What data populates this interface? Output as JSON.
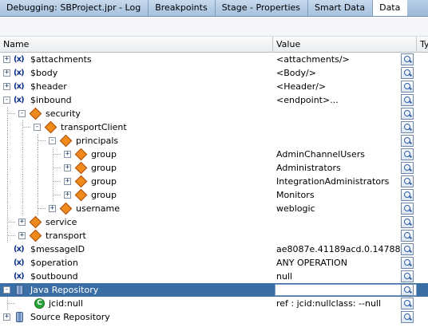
{
  "tabs": [
    {
      "label": "Debugging: SBProject.jpr - Log",
      "active": false
    },
    {
      "label": "Breakpoints",
      "active": false
    },
    {
      "label": "Stage - Properties",
      "active": false
    },
    {
      "label": "Smart Data",
      "active": false
    },
    {
      "label": "Data",
      "active": true
    }
  ],
  "columns": {
    "name": "Name",
    "value": "Value",
    "type": "Ty"
  },
  "rows": [
    {
      "name": "$attachments",
      "value": "<attachments/>",
      "icon": "variable-icon",
      "expander": "+",
      "depth": 0
    },
    {
      "name": "$body",
      "value": "<Body/>",
      "icon": "variable-icon",
      "expander": "+",
      "depth": 0
    },
    {
      "name": "$header",
      "value": "<Header/>",
      "icon": "variable-icon",
      "expander": "+",
      "depth": 0
    },
    {
      "name": "$inbound",
      "value": "<endpoint>...",
      "icon": "variable-icon",
      "expander": "-",
      "depth": 0
    },
    {
      "name": "security",
      "value": "",
      "icon": "element-icon",
      "expander": "-",
      "depth": 1
    },
    {
      "name": "transportClient",
      "value": "",
      "icon": "element-icon",
      "expander": "-",
      "depth": 2
    },
    {
      "name": "principals",
      "value": "",
      "icon": "element-icon",
      "expander": "-",
      "depth": 3
    },
    {
      "name": "group",
      "value": "AdminChannelUsers",
      "icon": "element-icon",
      "expander": "+",
      "depth": 4
    },
    {
      "name": "group",
      "value": "Administrators",
      "icon": "element-icon",
      "expander": "+",
      "depth": 4
    },
    {
      "name": "group",
      "value": "IntegrationAdministrators",
      "icon": "element-icon",
      "expander": "+",
      "depth": 4
    },
    {
      "name": "group",
      "value": "Monitors",
      "icon": "element-icon",
      "expander": "+",
      "depth": 4
    },
    {
      "name": "username",
      "value": "weblogic",
      "icon": "element-icon",
      "expander": "+",
      "depth": 3
    },
    {
      "name": "service",
      "value": "",
      "icon": "element-icon",
      "expander": "+",
      "depth": 1
    },
    {
      "name": "transport",
      "value": "",
      "icon": "element-icon",
      "expander": "+",
      "depth": 1
    },
    {
      "name": "$messageID",
      "value": "ae8087e.41189acd.0.1478896...",
      "icon": "variable-icon",
      "expander": "",
      "depth": 0
    },
    {
      "name": "$operation",
      "value": "ANY OPERATION",
      "icon": "variable-icon",
      "expander": "",
      "depth": 0
    },
    {
      "name": "$outbound",
      "value": "null",
      "icon": "variable-icon",
      "expander": "",
      "depth": 0
    },
    {
      "name": "Java Repository",
      "value": "",
      "icon": "repository-icon",
      "expander": "-",
      "depth": 0,
      "selected": true
    },
    {
      "name": "jcid:null",
      "value": "ref  : jcid:nullclass: --null",
      "icon": "class-icon",
      "expander": "",
      "depth": 1
    },
    {
      "name": "Source Repository",
      "value": "",
      "icon": "repository-icon",
      "expander": "+",
      "depth": 0
    }
  ],
  "colors": {
    "selection": "#3b6ea5",
    "element_icon": "#f08a1c",
    "variable_icon": "#0c2f8a"
  }
}
